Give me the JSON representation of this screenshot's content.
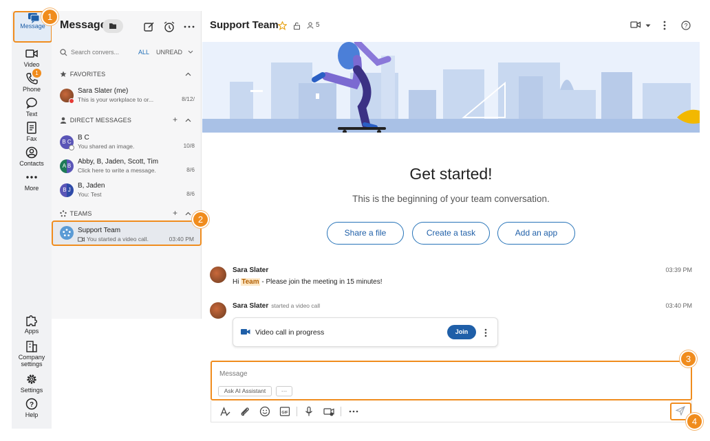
{
  "nav": {
    "items": [
      {
        "label": "Message",
        "icon": "chat-icon"
      },
      {
        "label": "Video",
        "icon": "video-icon"
      },
      {
        "label": "Phone",
        "icon": "phone-icon",
        "badge": "1"
      },
      {
        "label": "Text",
        "icon": "sms-icon"
      },
      {
        "label": "Fax",
        "icon": "fax-icon"
      },
      {
        "label": "Contacts",
        "icon": "contacts-icon"
      },
      {
        "label": "More",
        "icon": "more-icon"
      }
    ],
    "bottom": [
      {
        "label": "Apps",
        "icon": "puzzle-icon"
      },
      {
        "label": "Company settings",
        "icon": "building-icon"
      },
      {
        "label": "Settings",
        "icon": "gear-icon"
      },
      {
        "label": "Help",
        "icon": "help-icon"
      }
    ]
  },
  "list": {
    "title": "Message",
    "search_placeholder": "Search convers...",
    "filter_all": "ALL",
    "filter_unread": "UNREAD",
    "favorites_label": "FAVORITES",
    "direct_label": "DIRECT MESSAGES",
    "teams_label": "TEAMS",
    "favorites": [
      {
        "name": "Sara Slater (me)",
        "preview": "This is your workplace to or...",
        "time": "8/12/"
      }
    ],
    "direct": [
      {
        "initials": "B C",
        "name": "B C",
        "preview": "You shared an image.",
        "time": "10/8"
      },
      {
        "initials": "A B",
        "name": "Abby, B, Jaden, Scott, Tim",
        "preview": "Click here to write a message.",
        "time": "8/6"
      },
      {
        "initials": "B J",
        "name": "B, Jaden",
        "preview": "You: Test",
        "time": "8/6"
      }
    ],
    "teams": [
      {
        "name": "Support Team",
        "preview": "You started a video call.",
        "time": "03:40 PM"
      }
    ]
  },
  "header": {
    "title": "Support Team",
    "members": "5"
  },
  "intro": {
    "title": "Get started!",
    "subtitle": "This is the beginning of your team conversation.",
    "buttons": [
      "Share a file",
      "Create a task",
      "Add an app"
    ]
  },
  "messages": [
    {
      "author": "Sara Slater",
      "time": "03:39 PM",
      "text_before": "Hi ",
      "mention": "Team",
      "text_after": " - Please join the meeting in 15 minutes!"
    },
    {
      "author": "Sara Slater",
      "action": "started a video call",
      "time": "03:40 PM",
      "card_text": "Video call in progress",
      "join_label": "Join"
    }
  ],
  "composer": {
    "placeholder": "Message",
    "ai_label": "Ask AI Assistant",
    "more_label": "···"
  },
  "callouts": [
    "1",
    "2",
    "3",
    "4"
  ],
  "colors": {
    "accent": "#f08c1d",
    "brand": "#1f5fa8"
  }
}
